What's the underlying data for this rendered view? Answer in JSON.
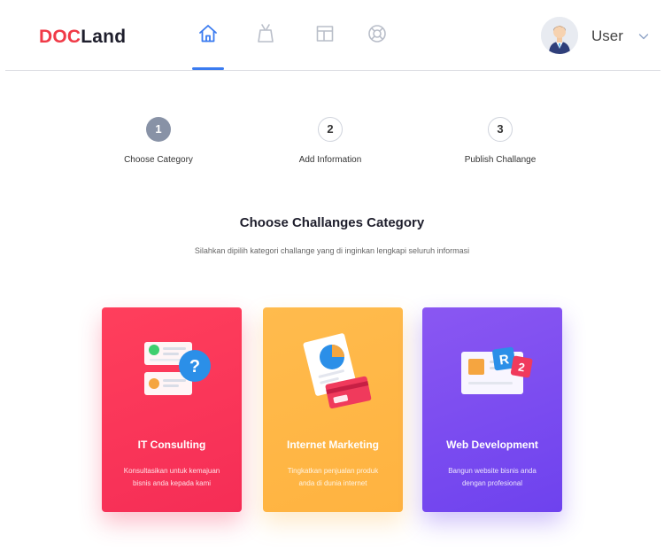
{
  "header": {
    "logo_accent": "DOC",
    "logo_rest": "Land",
    "nav_icons": [
      "home-icon",
      "tv-icon",
      "layout-icon",
      "lifebuoy-icon"
    ],
    "active_nav": "home",
    "user_name": "User",
    "accent_color": "#3a7bf0"
  },
  "steps": [
    {
      "number": "1",
      "label": "Choose Category",
      "state": "active"
    },
    {
      "number": "2",
      "label": "Add Information",
      "state": "inactive"
    },
    {
      "number": "3",
      "label": "Publish Challange",
      "state": "inactive"
    }
  ],
  "section": {
    "title": "Choose Challanges Category",
    "subtitle": "Silahkan dipilih kategori challange yang  di inginkan lengkapi seluruh informasi"
  },
  "cards": [
    {
      "title": "IT Consulting",
      "desc_line1": "Konsultasikan untuk kemajuan",
      "desc_line2": "bisnis anda kepada kami",
      "color": "#f7335a"
    },
    {
      "title": "Internet Marketing",
      "desc_line1": "Tingkatkan penjualan produk",
      "desc_line2": "anda di dunia internet",
      "color": "#ffb845"
    },
    {
      "title": "Web Development",
      "desc_line1": "Bangun website bisnis anda",
      "desc_line2": "dengan profesional",
      "color": "#7b4cf0"
    }
  ]
}
